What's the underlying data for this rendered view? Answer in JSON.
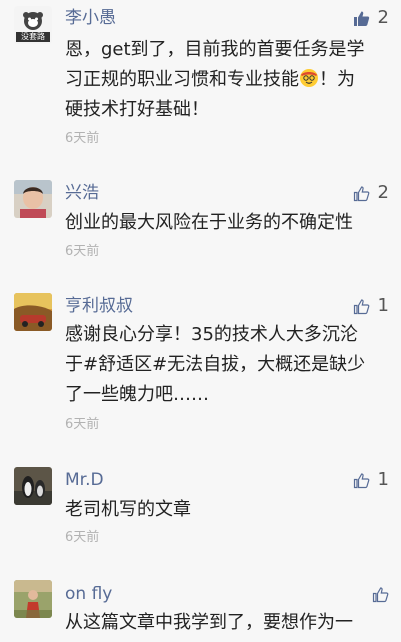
{
  "comments": [
    {
      "name": "李小愚",
      "likes": "2",
      "liked": true,
      "lines": [
        "恩，get到了，目前我的首要任务是学",
        "习正规的职业习惯和专业技能",
        "！为",
        "硬技术打好基础！"
      ],
      "time": "6天前",
      "avatar_text": "没套路",
      "emoji": "nerd-face-emoji"
    },
    {
      "name": "兴浩",
      "likes": "2",
      "liked": false,
      "lines": [
        "创业的最大风险在于业务的不确定性"
      ],
      "time": "6天前"
    },
    {
      "name": "亨利叔叔",
      "likes": "1",
      "liked": false,
      "lines": [
        "感谢良心分享！35的技术人大多沉沦",
        "于#舒适区#无法自拔，大概还是缺少",
        "了一些魄力吧……"
      ],
      "time": "6天前"
    },
    {
      "name": "Mr.D",
      "likes": "1",
      "liked": false,
      "lines": [
        "老司机写的文章"
      ],
      "time": "6天前"
    },
    {
      "name": "on fly",
      "likes": "",
      "liked": false,
      "lines": [
        "从这篇文章中我学到了，要想作为一"
      ],
      "time": ""
    }
  ],
  "colors": {
    "name": "#576b95",
    "liked": "#576b95",
    "unliked": "#576b95"
  }
}
